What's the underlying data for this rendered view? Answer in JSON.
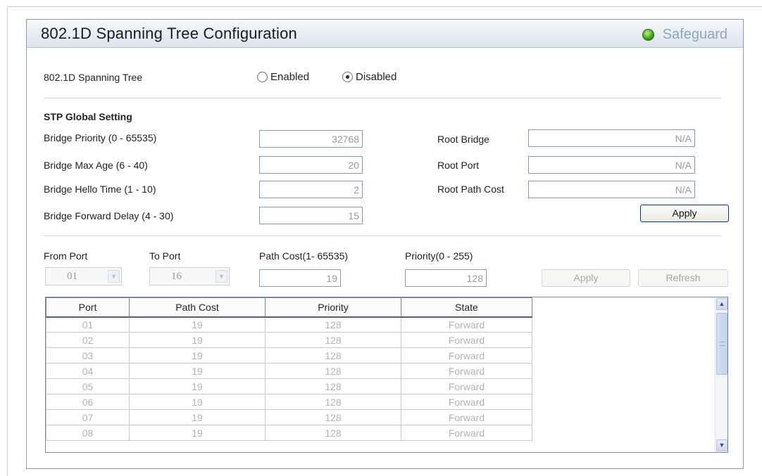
{
  "header": {
    "title": "802.1D Spanning Tree Configuration",
    "safeguard_label": "Safeguard"
  },
  "stp_state": {
    "label": "802.1D Spanning Tree",
    "enabled_label": "Enabled",
    "disabled_label": "Disabled",
    "selected": "Disabled"
  },
  "global": {
    "section_title": "STP Global Setting",
    "bridge_priority_label": "Bridge Priority (0 - 65535)",
    "bridge_priority_value": "32768",
    "max_age_label": "Bridge Max Age (6 - 40)",
    "max_age_value": "20",
    "hello_time_label": "Bridge Hello Time (1 - 10)",
    "hello_time_value": "2",
    "forward_delay_label": "Bridge Forward  Delay (4 - 30)",
    "forward_delay_value": "15",
    "root_bridge_label": "Root Bridge",
    "root_bridge_value": "N/A",
    "root_port_label": "Root Port",
    "root_port_value": "N/A",
    "root_path_cost_label": "Root Path Cost",
    "root_path_cost_value": "N/A",
    "apply_label": "Apply"
  },
  "port_settings": {
    "from_port_label": "From Port",
    "from_port_value": "01",
    "to_port_label": "To Port",
    "to_port_value": "16",
    "path_cost_label": "Path Cost(1- 65535)",
    "path_cost_value": "19",
    "priority_label": "Priority(0 - 255)",
    "priority_value": "128",
    "apply_label": "Apply",
    "refresh_label": "Refresh"
  },
  "table": {
    "columns": [
      "Port",
      "Path Cost",
      "Priority",
      "State"
    ],
    "rows": [
      [
        "01",
        "19",
        "128",
        "Forward"
      ],
      [
        "02",
        "19",
        "128",
        "Forward"
      ],
      [
        "03",
        "19",
        "128",
        "Forward"
      ],
      [
        "04",
        "19",
        "128",
        "Forward"
      ],
      [
        "05",
        "19",
        "128",
        "Forward"
      ],
      [
        "06",
        "19",
        "128",
        "Forward"
      ],
      [
        "07",
        "19",
        "128",
        "Forward"
      ],
      [
        "08",
        "19",
        "128",
        "Forward"
      ]
    ]
  },
  "icons": {
    "status": "green-status-dot-icon",
    "dropdown": "chevron-down-icon",
    "scroll_up": "arrow-up-icon",
    "scroll_down": "arrow-down-icon"
  },
  "colors": {
    "status_green": "#39a013",
    "safeguard_text": "#8ea5c0",
    "panel_border": "#8a9cb2"
  }
}
